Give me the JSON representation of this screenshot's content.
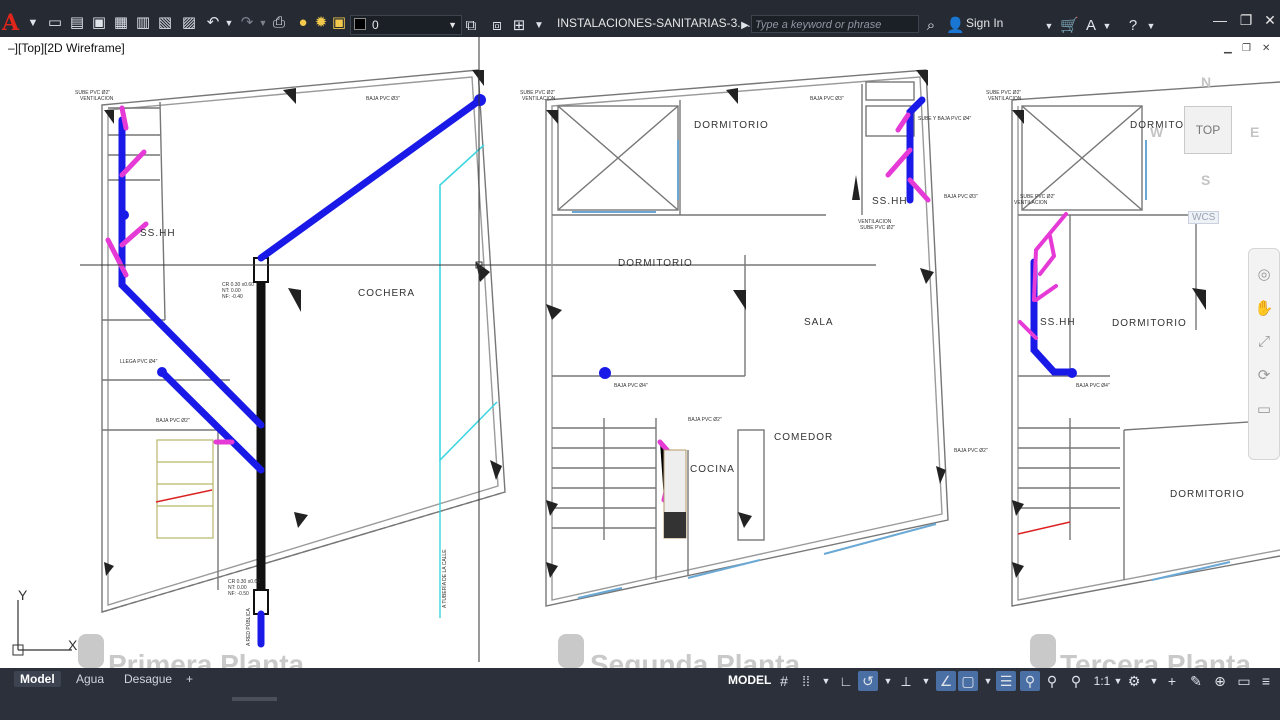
{
  "app": {
    "logo": "A",
    "title": "INSTALACIONES-SANITARIAS-3....",
    "search_placeholder": "Type a keyword or phrase",
    "sign_in": "Sign In"
  },
  "layer": {
    "current": "0"
  },
  "viewport": {
    "label": "–][Top][2D Wireframe]"
  },
  "viewcube": {
    "face": "TOP",
    "north": "N",
    "south": "S",
    "east": "E",
    "west": "W",
    "wcs": "WCS"
  },
  "ucs": {
    "x": "X",
    "y": "Y"
  },
  "layout_tabs": [
    {
      "label": "Model",
      "active": true
    },
    {
      "label": "Agua",
      "active": false
    },
    {
      "label": "Desague",
      "active": false
    },
    {
      "label": "+",
      "active": false
    }
  ],
  "status": {
    "model": "MODEL",
    "scale": "1:1"
  },
  "drawing": {
    "plan_titles": [
      "Primera Planta",
      "Segunda Planta",
      "Tercera Planta"
    ],
    "rooms": {
      "cochera": "COCHERA",
      "dormitorio": "DORMITORIO",
      "sala": "SALA",
      "comedor": "COMEDOR",
      "cocina": "COCINA",
      "ss_hh": "SS.HH"
    },
    "notes": {
      "sube_vent": "SUBE PVC Ø2\"",
      "ventilacion": "VENTILACION",
      "baja_3": "BAJA PVC Ø3\"",
      "baja_4": "BAJA PVC Ø4\"",
      "baja_2": "BAJA PVC Ø2\"",
      "llega_4": "LLEGA PVC Ø4\"",
      "sube_baja_4": "SUBE Y BAJA PVC Ø4\"",
      "red_publica": "A RED PÚBLICA",
      "red_calle": "A TUBERÍA DE LA CALLE",
      "cr1": "CR 0.30 x0.60",
      "ct": "NT: 0.00",
      "nf": "NF: -0.40",
      "cr2": "CR 0.30 x0.60",
      "ct2": "NT: 0.00",
      "nf2": "NF: -0.50"
    }
  }
}
